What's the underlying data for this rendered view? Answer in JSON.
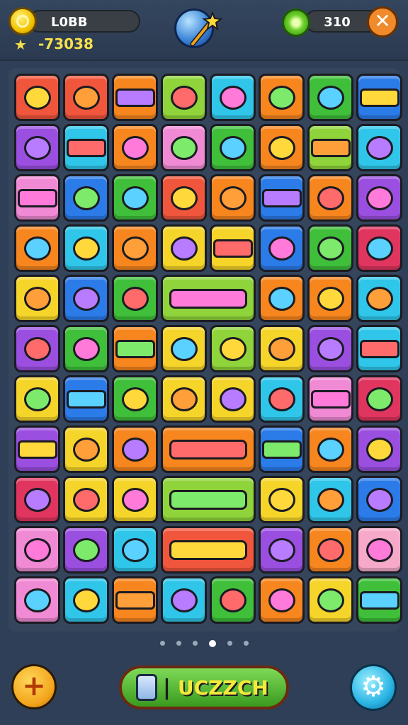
{
  "header": {
    "player_name": "L0BB",
    "score": "-73038",
    "gems": "310",
    "close_label": "✕",
    "icons": [
      "coin-icon",
      "star-icon",
      "magic-orb-icon",
      "wand-icon",
      "gem-icon",
      "close-icon"
    ]
  },
  "colors": {
    "red": "#f0563c",
    "orange": "#f7861f",
    "yellow": "#f6d52a",
    "lime": "#8fd43a",
    "green": "#3fbf3a",
    "cyan": "#2fc6ea",
    "blue": "#2b7be8",
    "purple": "#9a4fe0",
    "pink": "#f08ad4",
    "magenta": "#e0355f",
    "lightpink": "#f6a9c9"
  },
  "board": {
    "rows": [
      [
        "red",
        "red",
        "orange",
        "lime",
        "cyan",
        "orange",
        "green",
        "blue"
      ],
      [
        "purple",
        "cyan",
        "orange",
        "pink",
        "green",
        "orange",
        "lime",
        "cyan"
      ],
      [
        "pink",
        "blue",
        "green",
        "red",
        "orange",
        "blue",
        "orange",
        "purple"
      ],
      [
        "orange",
        "cyan",
        "orange",
        "yellow",
        "yellow",
        "blue",
        "green",
        "magenta"
      ],
      [
        "yellow",
        "blue",
        "green",
        "wide-lime",
        "wide-lime",
        "orange",
        "orange",
        "cyan"
      ],
      [
        "purple",
        "green",
        "orange",
        "yellow",
        "lime",
        "yellow",
        "purple",
        "cyan"
      ],
      [
        "yellow",
        "blue",
        "green",
        "yellow",
        "yellow",
        "cyan",
        "pink",
        "magenta"
      ],
      [
        "purple",
        "yellow",
        "orange",
        "wide-orange",
        "wide-orange",
        "blue",
        "orange",
        "purple"
      ],
      [
        "magenta",
        "yellow",
        "yellow",
        "wide-lime",
        "wide-lime",
        "yellow",
        "cyan",
        "blue"
      ],
      [
        "pink",
        "purple",
        "cyan",
        "wide-red",
        "wide-red",
        "purple",
        "orange",
        "lightpink"
      ],
      [
        "pink",
        "cyan",
        "orange",
        "cyan",
        "green",
        "orange",
        "yellow",
        "green"
      ]
    ]
  },
  "pagination": {
    "count": 6,
    "active": 3
  },
  "footer": {
    "left_button": "+",
    "main_button_separator": "|",
    "main_button_label": "UCZZCH",
    "right_button_icon": "⚙"
  }
}
